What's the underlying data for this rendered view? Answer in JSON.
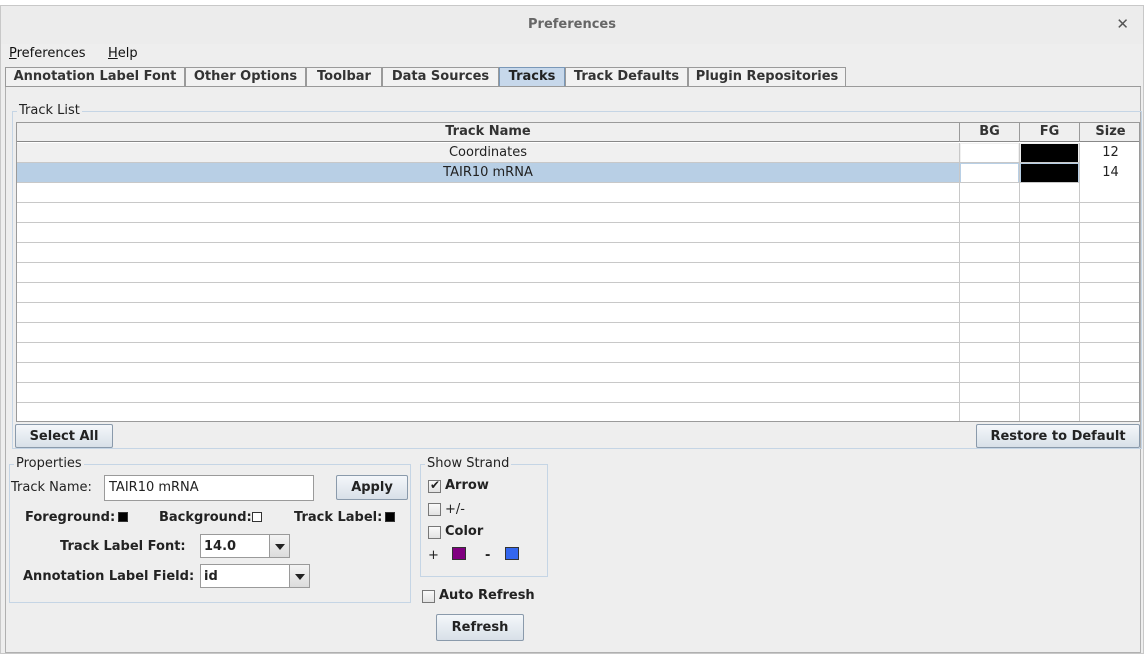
{
  "window": {
    "title": "Preferences"
  },
  "menubar": {
    "preferences_first": "P",
    "preferences_rest": "references",
    "help_first": "H",
    "help_rest": "elp"
  },
  "tabs": [
    {
      "label": "Annotation Label Font"
    },
    {
      "label": "Other Options"
    },
    {
      "label": "Toolbar"
    },
    {
      "label": "Data Sources"
    },
    {
      "label": "Tracks",
      "active": true
    },
    {
      "label": "Track Defaults"
    },
    {
      "label": "Plugin Repositories"
    }
  ],
  "track_list": {
    "title": "Track List",
    "columns": [
      "Track Name",
      "BG",
      "FG",
      "Size"
    ],
    "rows": [
      {
        "name": "Coordinates",
        "bg": "#ffffff",
        "fg": "#000000",
        "size": "12"
      },
      {
        "name": "TAIR10 mRNA",
        "bg": "#ffffff",
        "fg": "#000000",
        "size": "14",
        "selected": true
      }
    ],
    "select_all": "Select All",
    "restore_default": "Restore to Default"
  },
  "properties": {
    "title": "Properties",
    "track_name_label": "Track Name:",
    "track_name_value": "TAIR10 mRNA",
    "apply": "Apply",
    "foreground_label": "Foreground:",
    "foreground_color": "#000000",
    "background_label": "Background:",
    "background_color": "#ffffff",
    "track_label_label": "Track Label:",
    "track_label_color": "#000000",
    "track_label_font_label": "Track Label Font:",
    "track_label_font_value": "14.0",
    "annotation_label_field_label": "Annotation Label Field:",
    "annotation_label_field_value": "id"
  },
  "show_strand": {
    "title": "Show Strand",
    "arrow_label": "Arrow",
    "arrow_checked": true,
    "plusminus_label": "+/-",
    "plusminus_checked": false,
    "color_label": "Color",
    "color_checked": false,
    "plus_symbol": "+",
    "plus_color": "#800080",
    "minus_symbol": "-",
    "minus_color": "#3366ee"
  },
  "auto_refresh": {
    "label": "Auto Refresh",
    "checked": false
  },
  "refresh": "Refresh"
}
